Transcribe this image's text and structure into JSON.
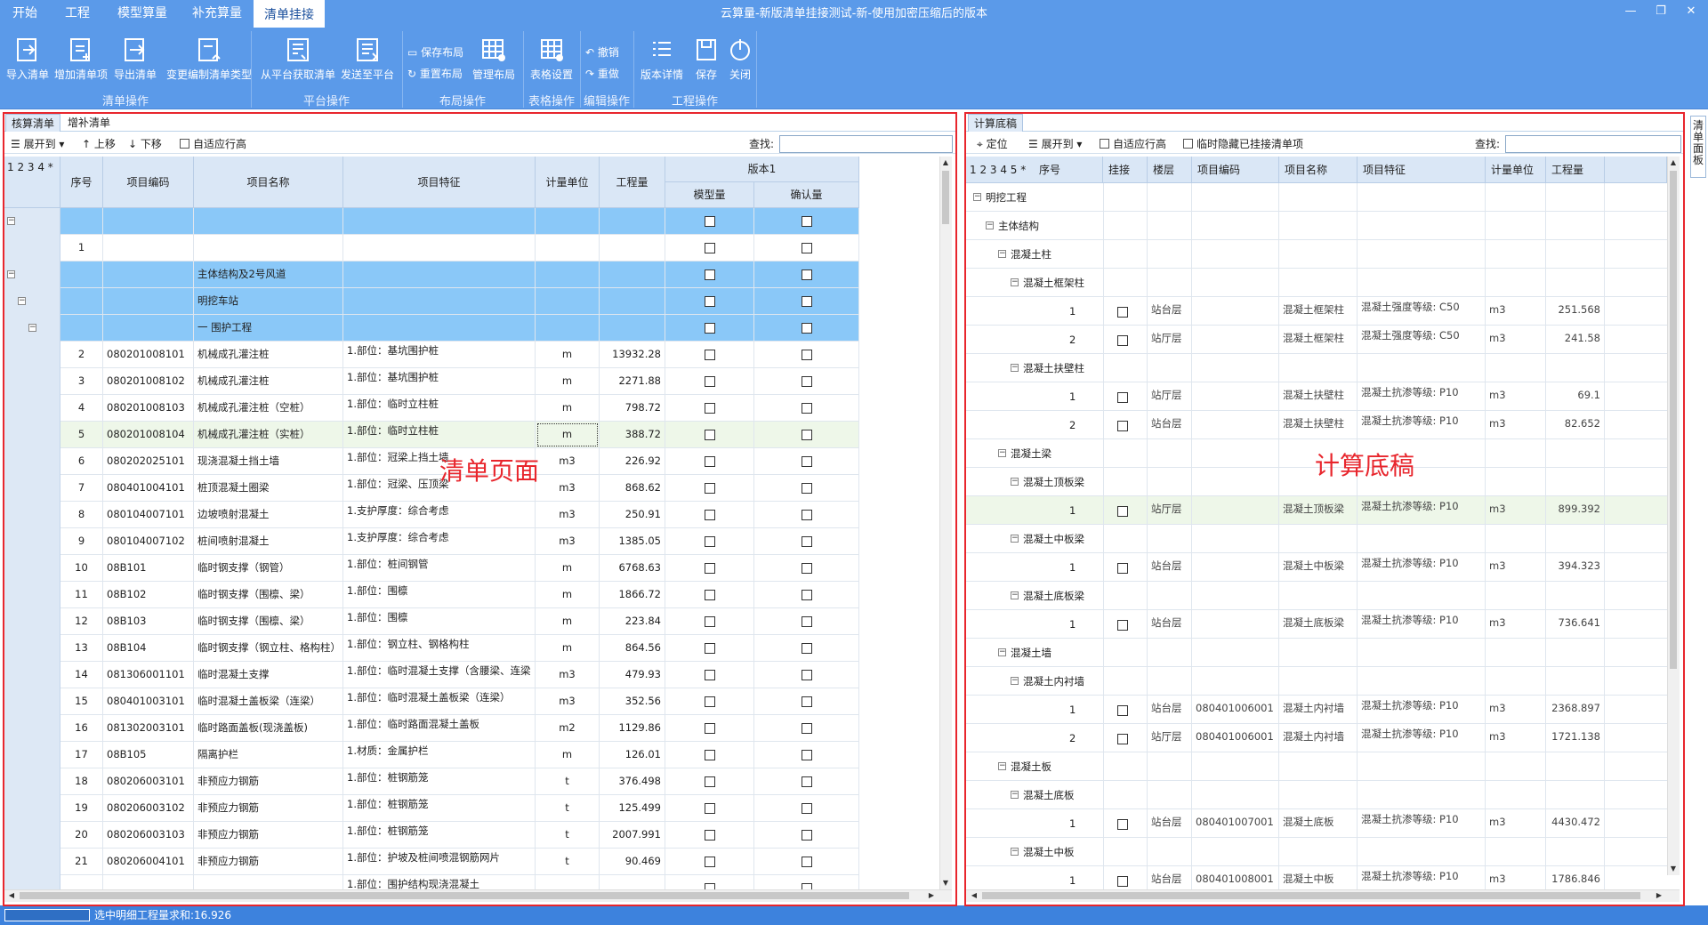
{
  "menu": {
    "items": [
      "开始",
      "工程",
      "模型算量",
      "补充算量",
      "清单挂接"
    ],
    "active_index": 4,
    "title": "云算量-新版清单挂接测试-新-使用加密压缩后的版本"
  },
  "ribbon": {
    "buttons": [
      {
        "label": "导入清单",
        "icon": "import-list-icon"
      },
      {
        "label": "增加清单项",
        "icon": "add-list-item-icon"
      },
      {
        "label": "导出清单",
        "icon": "export-list-icon"
      },
      {
        "label": "变更编制清单类型",
        "icon": "change-list-type-icon"
      },
      {
        "label": "从平台获取清单",
        "icon": "fetch-from-platform-icon"
      },
      {
        "label": "发送至平台",
        "icon": "send-to-platform-icon"
      },
      {
        "label": "表格设置",
        "icon": "table-settings-icon"
      },
      {
        "label": "版本详情",
        "icon": "version-details-icon"
      },
      {
        "label": "保存",
        "icon": "save-icon"
      },
      {
        "label": "关闭",
        "icon": "power-icon"
      }
    ],
    "small_buttons": [
      {
        "label": "保存布局",
        "icon": "save-layout-icon"
      },
      {
        "label": "重置布局",
        "icon": "reset-layout-icon"
      },
      {
        "label": "管理布局",
        "icon": "manage-layout-icon"
      },
      {
        "label": "撤销",
        "icon": "undo-icon"
      },
      {
        "label": "重做",
        "icon": "redo-icon"
      }
    ],
    "groups": [
      "清单操作",
      "平台操作",
      "布局操作",
      "表格操作",
      "编辑操作",
      "工程操作"
    ]
  },
  "left": {
    "tabs": [
      "核算清单",
      "增补清单"
    ],
    "toolbar": {
      "expand": "展开到",
      "up": "上移",
      "down": "下移",
      "autofit": "自适应行高",
      "search_label": "查找:"
    },
    "levels": "1 2 3 4 *",
    "headers": {
      "seq": "序号",
      "code": "项目编码",
      "name": "项目名称",
      "feature": "项目特征",
      "unit": "计量单位",
      "qty": "工程量",
      "version": "版本1",
      "model_qty": "模型量",
      "confirm_qty": "确认量"
    },
    "rows": [
      {
        "seq": "",
        "code": "",
        "name": "",
        "feature": "",
        "unit": "",
        "qty": "",
        "group": true
      },
      {
        "seq": "1",
        "code": "",
        "name": "",
        "feature": "",
        "unit": "",
        "qty": "",
        "group": false
      },
      {
        "seq": "",
        "code": "",
        "name": "主体结构及2号风道",
        "feature": "",
        "unit": "",
        "qty": "",
        "group": true
      },
      {
        "seq": "",
        "code": "",
        "name": "明挖车站",
        "feature": "",
        "unit": "",
        "qty": "",
        "group": true
      },
      {
        "seq": "",
        "code": "",
        "name": "一 围护工程",
        "feature": "",
        "unit": "",
        "qty": "",
        "group": true
      },
      {
        "seq": "2",
        "code": "080201008101",
        "name": "机械成孔灌注桩",
        "feature": "1.部位：基坑围护桩",
        "unit": "m",
        "qty": "13932.28",
        "group": false
      },
      {
        "seq": "3",
        "code": "080201008102",
        "name": "机械成孔灌注桩",
        "feature": "1.部位：基坑围护桩",
        "unit": "m",
        "qty": "2271.88",
        "group": false
      },
      {
        "seq": "4",
        "code": "080201008103",
        "name": "机械成孔灌注桩（空桩）",
        "feature": "1.部位：临时立柱桩",
        "unit": "m",
        "qty": "798.72",
        "group": false
      },
      {
        "seq": "5",
        "code": "080201008104",
        "name": "机械成孔灌注桩（实桩）",
        "feature": "1.部位：临时立柱桩",
        "unit": "m",
        "qty": "388.72",
        "group": false,
        "selected": true
      },
      {
        "seq": "6",
        "code": "080202025101",
        "name": "现浇混凝土挡土墙",
        "feature": "1.部位：冠梁上挡土墙",
        "unit": "m3",
        "qty": "226.92",
        "group": false
      },
      {
        "seq": "7",
        "code": "080401004101",
        "name": "桩顶混凝土圈梁",
        "feature": "1.部位：冠梁、压顶梁",
        "unit": "m3",
        "qty": "868.62",
        "group": false
      },
      {
        "seq": "8",
        "code": "080104007101",
        "name": "边坡喷射混凝土",
        "feature": "1.支护厚度：综合考虑",
        "unit": "m3",
        "qty": "250.91",
        "group": false
      },
      {
        "seq": "9",
        "code": "080104007102",
        "name": "桩间喷射混凝土",
        "feature": "1.支护厚度：综合考虑",
        "unit": "m3",
        "qty": "1385.05",
        "group": false
      },
      {
        "seq": "10",
        "code": "08B101",
        "name": "临时钢支撑（钢管）",
        "feature": "1.部位：桩间钢管",
        "unit": "m",
        "qty": "6768.63",
        "group": false
      },
      {
        "seq": "11",
        "code": "08B102",
        "name": "临时钢支撑（围檩、梁）",
        "feature": "1.部位：围檩",
        "unit": "m",
        "qty": "1866.72",
        "group": false
      },
      {
        "seq": "12",
        "code": "08B103",
        "name": "临时钢支撑（围檩、梁）",
        "feature": "1.部位：围檩",
        "unit": "m",
        "qty": "223.84",
        "group": false
      },
      {
        "seq": "13",
        "code": "08B104",
        "name": "临时钢支撑（钢立柱、格构柱）",
        "feature": "1.部位：钢立柱、钢格构柱",
        "unit": "m",
        "qty": "864.56",
        "group": false
      },
      {
        "seq": "14",
        "code": "081306001101",
        "name": "临时混凝土支撑",
        "feature": "1.部位：临时混凝土支撑（含腰梁、连梁",
        "unit": "m3",
        "qty": "479.93",
        "group": false
      },
      {
        "seq": "15",
        "code": "080401003101",
        "name": "临时混凝土盖板梁（连梁）",
        "feature": "1.部位：临时混凝土盖板梁（连梁）",
        "unit": "m3",
        "qty": "352.56",
        "group": false
      },
      {
        "seq": "16",
        "code": "081302003101",
        "name": "临时路面盖板(现浇盖板)",
        "feature": "1.部位：临时路面混凝土盖板",
        "unit": "m2",
        "qty": "1129.86",
        "group": false
      },
      {
        "seq": "17",
        "code": "08B105",
        "name": "隔离护栏",
        "feature": "1.材质：金属护栏",
        "unit": "m",
        "qty": "126.01",
        "group": false
      },
      {
        "seq": "18",
        "code": "080206003101",
        "name": "非预应力钢筋",
        "feature": "1.部位：桩钢筋笼",
        "unit": "t",
        "qty": "376.498",
        "group": false
      },
      {
        "seq": "19",
        "code": "080206003102",
        "name": "非预应力钢筋",
        "feature": "1.部位：桩钢筋笼",
        "unit": "t",
        "qty": "125.499",
        "group": false
      },
      {
        "seq": "20",
        "code": "080206003103",
        "name": "非预应力钢筋",
        "feature": "1.部位：桩钢筋笼",
        "unit": "t",
        "qty": "2007.991",
        "group": false
      },
      {
        "seq": "21",
        "code": "080206004101",
        "name": "非预应力钢筋",
        "feature": "1.部位：护坡及桩间喷混钢筋网片",
        "unit": "t",
        "qty": "90.469",
        "group": false
      },
      {
        "seq": "",
        "code": "",
        "name": "",
        "feature": "1.部位：围护结构现浇混凝土",
        "unit": "",
        "qty": "",
        "group": false
      }
    ],
    "annotation": "清单页面"
  },
  "right": {
    "tabs": [
      "计算底稿"
    ],
    "toolbar": {
      "locate": "定位",
      "expand": "展开到",
      "autofit": "自适应行高",
      "hide": "临时隐藏已挂接清单项",
      "search_label": "查找:"
    },
    "levels": "1 2 3 4 5 *",
    "headers": {
      "seq": "序号",
      "attach": "挂接",
      "floor": "楼层",
      "code": "项目编码",
      "name": "项目名称",
      "feature": "项目特征",
      "unit": "计量单位",
      "qty": "工程量"
    },
    "rows": [
      {
        "label": "明挖工程",
        "level": 0
      },
      {
        "label": "主体结构",
        "level": 1
      },
      {
        "label": "混凝土柱",
        "level": 2
      },
      {
        "label": "混凝土框架柱",
        "level": 3
      },
      {
        "label": "1",
        "level": 4,
        "floor": "站台层",
        "code": "",
        "name": "混凝土框架柱",
        "feature": "混凝土强度等级: C50",
        "unit": "m3",
        "qty": "251.568",
        "leaf": true
      },
      {
        "label": "2",
        "level": 4,
        "floor": "站厅层",
        "code": "",
        "name": "混凝土框架柱",
        "feature": "混凝土强度等级: C50",
        "unit": "m3",
        "qty": "241.58",
        "leaf": true
      },
      {
        "label": "混凝土扶壁柱",
        "level": 3
      },
      {
        "label": "1",
        "level": 4,
        "floor": "站厅层",
        "code": "",
        "name": "混凝土扶壁柱",
        "feature": "混凝土抗渗等级: P10",
        "unit": "m3",
        "qty": "69.1",
        "leaf": true
      },
      {
        "label": "2",
        "level": 4,
        "floor": "站台层",
        "code": "",
        "name": "混凝土扶壁柱",
        "feature": "混凝土抗渗等级: P10",
        "unit": "m3",
        "qty": "82.652",
        "leaf": true
      },
      {
        "label": "混凝土梁",
        "level": 2
      },
      {
        "label": "混凝土顶板梁",
        "level": 3
      },
      {
        "label": "1",
        "level": 4,
        "floor": "站厅层",
        "code": "",
        "name": "混凝土顶板梁",
        "feature": "混凝土抗渗等级: P10",
        "unit": "m3",
        "qty": "899.392",
        "leaf": true,
        "selected": true
      },
      {
        "label": "混凝土中板梁",
        "level": 3
      },
      {
        "label": "1",
        "level": 4,
        "floor": "站台层",
        "code": "",
        "name": "混凝土中板梁",
        "feature": "混凝土抗渗等级: P10",
        "unit": "m3",
        "qty": "394.323",
        "leaf": true
      },
      {
        "label": "混凝土底板梁",
        "level": 3
      },
      {
        "label": "1",
        "level": 4,
        "floor": "站台层",
        "code": "",
        "name": "混凝土底板梁",
        "feature": "混凝土抗渗等级: P10",
        "unit": "m3",
        "qty": "736.641",
        "leaf": true
      },
      {
        "label": "混凝土墙",
        "level": 2
      },
      {
        "label": "混凝土内衬墙",
        "level": 3
      },
      {
        "label": "1",
        "level": 4,
        "floor": "站台层",
        "code": "080401006001",
        "name": "混凝土内衬墙",
        "feature": "混凝土抗渗等级: P10",
        "unit": "m3",
        "qty": "2368.897",
        "leaf": true
      },
      {
        "label": "2",
        "level": 4,
        "floor": "站厅层",
        "code": "080401006001",
        "name": "混凝土内衬墙",
        "feature": "混凝土抗渗等级: P10",
        "unit": "m3",
        "qty": "1721.138",
        "leaf": true
      },
      {
        "label": "混凝土板",
        "level": 2
      },
      {
        "label": "混凝土底板",
        "level": 3
      },
      {
        "label": "1",
        "level": 4,
        "floor": "站台层",
        "code": "080401007001",
        "name": "混凝土底板",
        "feature": "混凝土抗渗等级: P10",
        "unit": "m3",
        "qty": "4430.472",
        "leaf": true
      },
      {
        "label": "混凝土中板",
        "level": 3
      },
      {
        "label": "1",
        "level": 4,
        "floor": "站台层",
        "code": "080401008001",
        "name": "混凝土中板",
        "feature": "混凝土抗渗等级: P10",
        "unit": "m3",
        "qty": "1786.846",
        "leaf": true
      }
    ],
    "annotation": "计算底稿"
  },
  "side_tab": "清单面板",
  "status": {
    "text": "选中明细工程量求和:16.926"
  },
  "colors": {
    "accent": "#5b9ae9",
    "group_row": "#8ac8f8",
    "selected_row": "#eef7e9",
    "annotation": "#e8262d"
  }
}
